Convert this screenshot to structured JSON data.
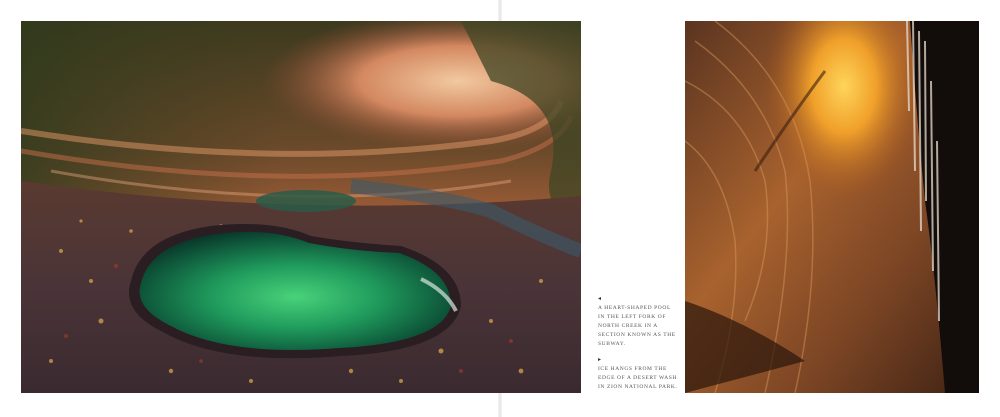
{
  "captions": [
    {
      "marker": "◂",
      "text": "A heart-shaped pool in the left fork of North Creek in a section known as the Subway."
    },
    {
      "marker": "▸",
      "text": "Ice hangs from the edge of a desert wash in Zion National Park."
    }
  ],
  "photos": {
    "left_subject": "heart-shaped pool in canyon tunnel",
    "right_subject": "sandstone slot canyon with hanging ice"
  }
}
